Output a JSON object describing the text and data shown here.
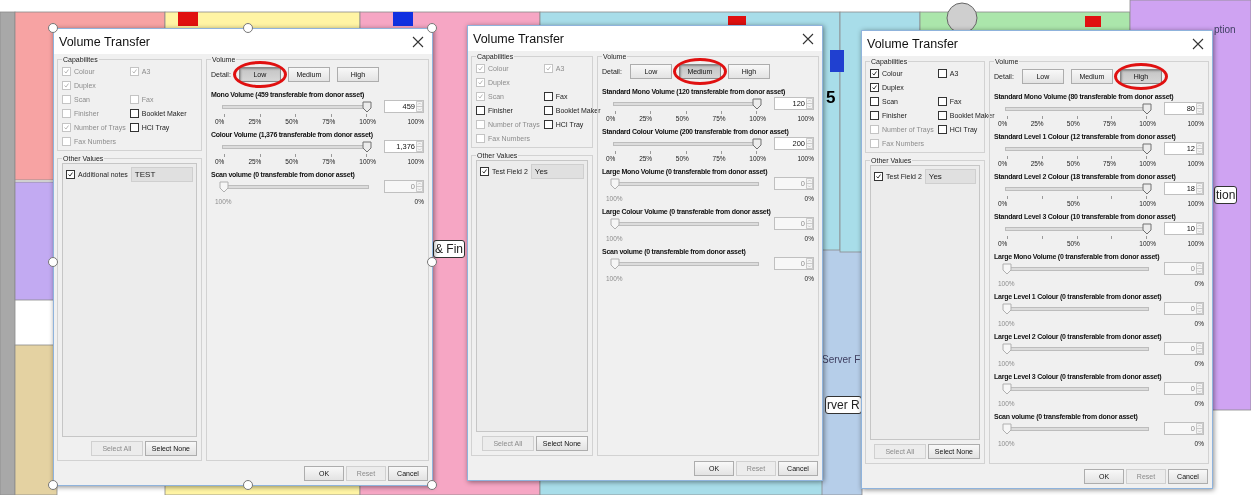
{
  "background": {
    "labels": [
      {
        "text": "ption",
        "kind": "faint"
      },
      {
        "text": "& Fin",
        "kind": "boxed"
      },
      {
        "text": "5",
        "kind": "bold"
      },
      {
        "text": "Server F",
        "kind": "faint"
      },
      {
        "text": "rver R",
        "kind": "boxed"
      },
      {
        "text": "tion",
        "kind": "boxed"
      }
    ]
  },
  "dialogs": [
    {
      "title": "Volume Transfer",
      "selected": true,
      "capabilities": {
        "legend": "Capabilites",
        "rows": [
          [
            {
              "label": "Colour",
              "checked": true,
              "disabled": true
            },
            {
              "label": "A3",
              "checked": true,
              "disabled": true
            }
          ],
          [
            {
              "label": "Duplex",
              "checked": true,
              "disabled": true
            }
          ],
          [
            {
              "label": "Scan",
              "checked": false,
              "disabled": true
            },
            {
              "label": "Fax",
              "checked": false,
              "disabled": true
            }
          ],
          [
            {
              "label": "Finisher",
              "checked": false,
              "disabled": true
            },
            {
              "label": "Booklet Maker",
              "checked": false,
              "disabled": false
            }
          ],
          [
            {
              "label": "Number of Trays",
              "checked": true,
              "disabled": true
            },
            {
              "label": "HCI Tray",
              "checked": false,
              "disabled": false
            }
          ],
          [
            {
              "label": "Fax Numbers",
              "checked": false,
              "disabled": true
            }
          ]
        ]
      },
      "other_values": {
        "legend": "Other Values",
        "fields": [
          {
            "label": "Additional notes",
            "checked": true,
            "value": "TEST"
          }
        ],
        "buttons": [
          {
            "label": "Select All",
            "disabled": true
          },
          {
            "label": "Select None",
            "disabled": false
          }
        ]
      },
      "volume": {
        "legend": "Volume",
        "detail_label": "Detail:",
        "detail": [
          {
            "label": "Low",
            "selected": true
          },
          {
            "label": "Medium",
            "selected": false
          },
          {
            "label": "High",
            "selected": false
          }
        ],
        "sliders": [
          {
            "label": "Mono Volume (459 transferable from donor asset)",
            "level": 1,
            "value": "459",
            "disabled": false,
            "ticks": [
              "0%",
              "25%",
              "50%",
              "75%",
              "100%"
            ],
            "reading": "100%"
          },
          {
            "label": "Colour Volume (1,376 transferable from donor asset)",
            "level": 1,
            "value": "1,376",
            "disabled": false,
            "ticks": [
              "0%",
              "25%",
              "50%",
              "75%",
              "100%"
            ],
            "reading": "100%"
          },
          {
            "label": "Scan volume (0 transferable from donor asset)",
            "level": 0,
            "value": "0",
            "disabled": true,
            "ticks": [
              "100%"
            ],
            "reading": "0%"
          }
        ]
      },
      "buttons": [
        {
          "label": "OK",
          "disabled": false
        },
        {
          "label": "Reset",
          "disabled": true
        },
        {
          "label": "Cancel",
          "disabled": false
        }
      ]
    },
    {
      "title": "Volume Transfer",
      "selected": false,
      "capabilities": {
        "legend": "Capabilities",
        "rows": [
          [
            {
              "label": "Colour",
              "checked": true,
              "disabled": true
            },
            {
              "label": "A3",
              "checked": true,
              "disabled": true
            }
          ],
          [
            {
              "label": "Duplex",
              "checked": true,
              "disabled": true
            }
          ],
          [
            {
              "label": "Scan",
              "checked": true,
              "disabled": true
            },
            {
              "label": "Fax",
              "checked": false,
              "disabled": false
            }
          ],
          [
            {
              "label": "Finisher",
              "checked": false,
              "disabled": false
            },
            {
              "label": "Booklet Maker",
              "checked": false,
              "disabled": false
            }
          ],
          [
            {
              "label": "Number of Trays",
              "checked": false,
              "disabled": true
            },
            {
              "label": "HCI Tray",
              "checked": false,
              "disabled": false
            }
          ],
          [
            {
              "label": "Fax Numbers",
              "checked": false,
              "disabled": true
            }
          ]
        ]
      },
      "other_values": {
        "legend": "Other Values",
        "fields": [
          {
            "label": "Test Field 2",
            "checked": true,
            "value": "Yes"
          }
        ],
        "buttons": [
          {
            "label": "Select All",
            "disabled": true
          },
          {
            "label": "Select None",
            "disabled": false
          }
        ]
      },
      "volume": {
        "legend": "Volume",
        "detail_label": "Detail:",
        "detail": [
          {
            "label": "Low",
            "selected": false
          },
          {
            "label": "Medium",
            "selected": true
          },
          {
            "label": "High",
            "selected": false
          }
        ],
        "sliders": [
          {
            "label": "Standard Mono Volume (120 transferable from donor asset)",
            "level": 1,
            "value": "120",
            "disabled": false,
            "ticks": [
              "0%",
              "25%",
              "50%",
              "75%",
              "100%"
            ],
            "reading": "100%"
          },
          {
            "label": "Standard Colour Volume (200 transferable from donor asset)",
            "level": 1,
            "value": "200",
            "disabled": false,
            "ticks": [
              "0%",
              "25%",
              "50%",
              "75%",
              "100%"
            ],
            "reading": "100%"
          },
          {
            "label": "Large Mono Volume (0 transferable from donor asset)",
            "level": 0,
            "value": "0",
            "disabled": true,
            "ticks": [
              "100%"
            ],
            "reading": "0%"
          },
          {
            "label": "Large Colour Volume (0 transferable from donor asset)",
            "level": 0,
            "value": "0",
            "disabled": true,
            "ticks": [
              "100%"
            ],
            "reading": "0%"
          },
          {
            "label": "Scan volume (0 transferable from donor asset)",
            "level": 0,
            "value": "0",
            "disabled": true,
            "ticks": [
              "100%"
            ],
            "reading": "0%"
          }
        ]
      },
      "buttons": [
        {
          "label": "OK",
          "disabled": false
        },
        {
          "label": "Reset",
          "disabled": true
        },
        {
          "label": "Cancel",
          "disabled": false
        }
      ]
    },
    {
      "title": "Volume Transfer",
      "selected": false,
      "capabilities": {
        "legend": "Capabilities",
        "rows": [
          [
            {
              "label": "Colour",
              "checked": true,
              "disabled": false
            },
            {
              "label": "A3",
              "checked": false,
              "disabled": false
            }
          ],
          [
            {
              "label": "Duplex",
              "checked": true,
              "disabled": false
            }
          ],
          [
            {
              "label": "Scan",
              "checked": false,
              "disabled": false
            },
            {
              "label": "Fax",
              "checked": false,
              "disabled": false
            }
          ],
          [
            {
              "label": "Finisher",
              "checked": false,
              "disabled": false
            },
            {
              "label": "Booklet Maker",
              "checked": false,
              "disabled": false
            }
          ],
          [
            {
              "label": "Number of Trays",
              "checked": false,
              "disabled": true
            },
            {
              "label": "HCI Tray",
              "checked": false,
              "disabled": false
            }
          ],
          [
            {
              "label": "Fax Numbers",
              "checked": false,
              "disabled": true
            }
          ]
        ]
      },
      "other_values": {
        "legend": "Other Values",
        "fields": [
          {
            "label": "Test Field 2",
            "checked": true,
            "value": "Yes"
          }
        ],
        "buttons": [
          {
            "label": "Select All",
            "disabled": true
          },
          {
            "label": "Select None",
            "disabled": false
          }
        ]
      },
      "volume": {
        "legend": "Volume",
        "detail_label": "Detail:",
        "detail": [
          {
            "label": "Low",
            "selected": false
          },
          {
            "label": "Medium",
            "selected": false
          },
          {
            "label": "High",
            "selected": true
          }
        ],
        "sliders": [
          {
            "label": "Standard Mono Volume (80 transferable from donor asset)",
            "level": 1,
            "value": "80",
            "disabled": false,
            "ticks": [
              "0%",
              "25%",
              "50%",
              "75%",
              "100%"
            ],
            "reading": "100%"
          },
          {
            "label": "Standard Level 1 Colour (12 transferable from donor asset)",
            "level": 1,
            "value": "12",
            "disabled": false,
            "ticks": [
              "0%",
              "25%",
              "50%",
              "75%",
              "100%"
            ],
            "reading": "100%"
          },
          {
            "label": "Standard Level 2 Colour (18 transferable from donor asset)",
            "level": 1,
            "value": "18",
            "disabled": false,
            "ticks": [
              "0%",
              "50%",
              "100%"
            ],
            "reading": "100%"
          },
          {
            "label": "Standard Level 3 Colour (10 transferable from donor asset)",
            "level": 1,
            "value": "10",
            "disabled": false,
            "ticks": [
              "0%",
              "50%",
              "100%"
            ],
            "reading": "100%"
          },
          {
            "label": "Large Mono Volume (0 transferable from donor asset)",
            "level": 0,
            "value": "0",
            "disabled": true,
            "ticks": [
              "100%"
            ],
            "reading": "0%"
          },
          {
            "label": "Large Level 1 Colour (0 transferable from donor asset)",
            "level": 0,
            "value": "0",
            "disabled": true,
            "ticks": [
              "100%"
            ],
            "reading": "0%"
          },
          {
            "label": "Large Level 2 Colour (0 transferable from donor asset)",
            "level": 0,
            "value": "0",
            "disabled": true,
            "ticks": [
              "100%"
            ],
            "reading": "0%"
          },
          {
            "label": "Large Level 3 Colour (0 transferable from donor asset)",
            "level": 0,
            "value": "0",
            "disabled": true,
            "ticks": [
              "100%"
            ],
            "reading": "0%"
          },
          {
            "label": "Scan volume (0 transferable from donor asset)",
            "level": 0,
            "value": "0",
            "disabled": true,
            "ticks": [
              "100%"
            ],
            "reading": "0%"
          }
        ]
      },
      "buttons": [
        {
          "label": "OK",
          "disabled": false
        },
        {
          "label": "Reset",
          "disabled": true
        },
        {
          "label": "Cancel",
          "disabled": false
        }
      ]
    }
  ]
}
